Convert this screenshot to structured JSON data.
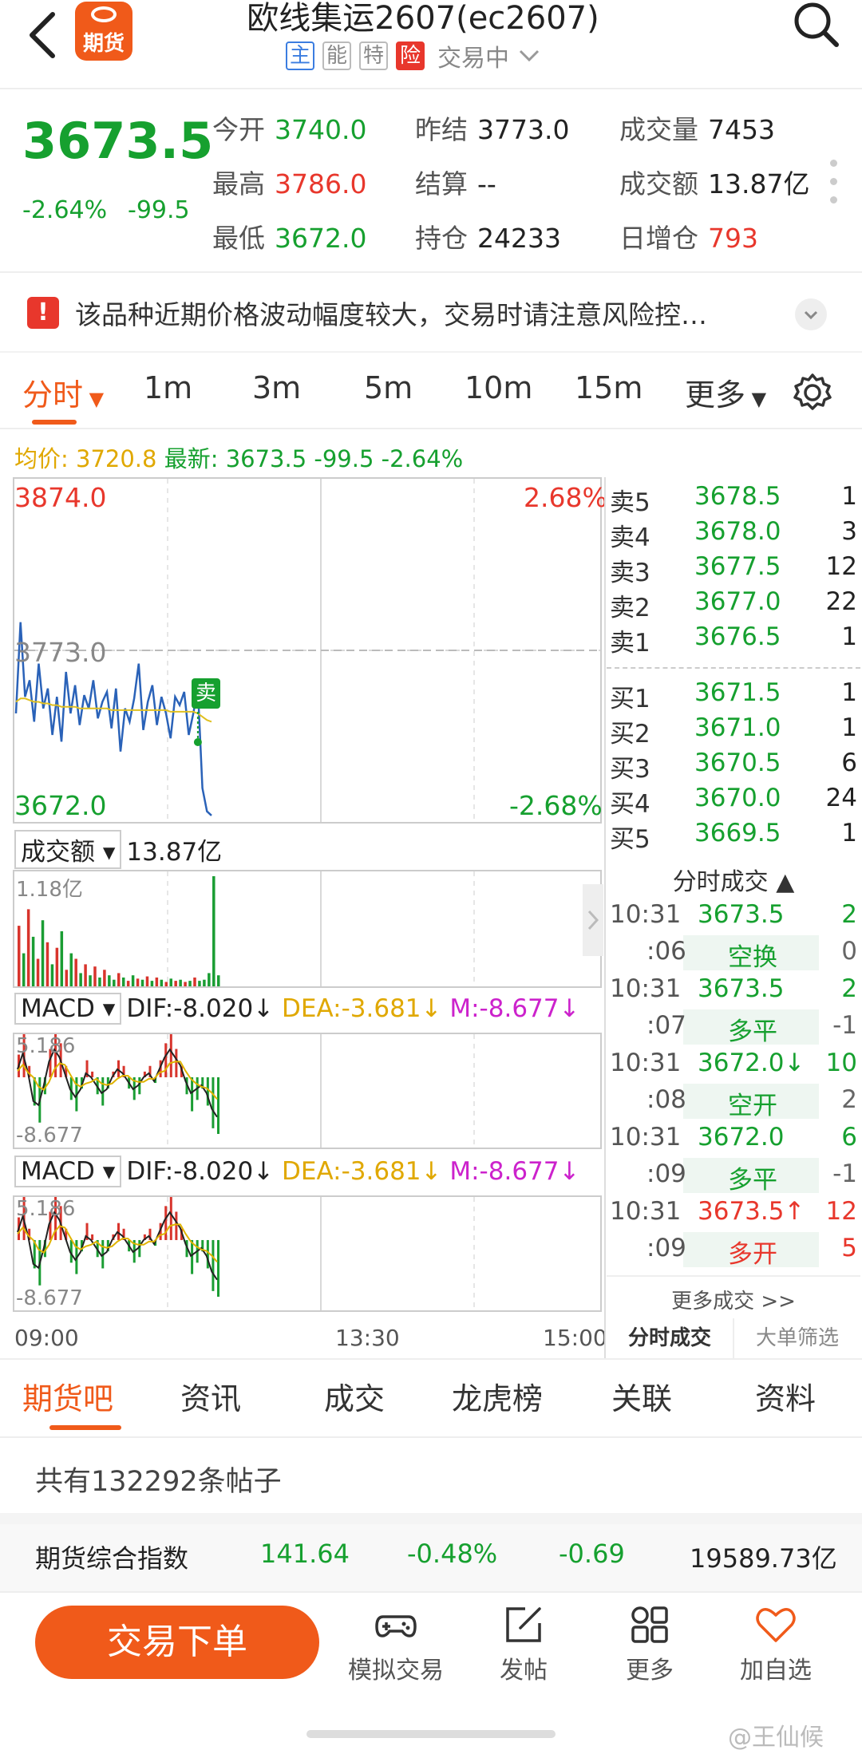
{
  "header": {
    "logo_text": "期货",
    "title": "欧线集运2607(ec2607)",
    "tags": [
      "主",
      "能",
      "特",
      "险"
    ],
    "status": "交易中"
  },
  "quote": {
    "last": "3673.5",
    "change_pct": "-2.64%",
    "change": "-99.5",
    "stats": {
      "open": {
        "label": "今开",
        "value": "3740.0"
      },
      "prev_settle": {
        "label": "昨结",
        "value": "3773.0"
      },
      "volume": {
        "label": "成交量",
        "value": "7453"
      },
      "high": {
        "label": "最高",
        "value": "3786.0"
      },
      "settle": {
        "label": "结算",
        "value": "--"
      },
      "turnover": {
        "label": "成交额",
        "value": "13.87亿"
      },
      "low": {
        "label": "最低",
        "value": "3672.0"
      },
      "open_interest": {
        "label": "持仓",
        "value": "24233"
      },
      "oi_change": {
        "label": "日增仓",
        "value": "793"
      }
    }
  },
  "warning": {
    "text": "该品种近期价格波动幅度较大，交易时请注意风险控…"
  },
  "period_tabs": [
    "分时",
    "1m",
    "3m",
    "5m",
    "10m",
    "15m",
    "更多"
  ],
  "avg_line": {
    "avg_label": "均价:",
    "avg_value": "3720.8",
    "latest_label": "最新:",
    "latest_value": "3673.5 -99.5 -2.64%"
  },
  "chart": {
    "top_price": "3874.0",
    "top_pct": "2.68%",
    "ref_price": "3773.0",
    "bottom_price": "3672.0",
    "bottom_pct": "-2.68%",
    "sell_marker": "卖",
    "time_start": "09:00",
    "time_mid": "13:30",
    "time_end": "15:00"
  },
  "chart_data": {
    "type": "line",
    "title": "",
    "ylim": [
      3672.0,
      3874.0
    ],
    "reference": 3773.0,
    "series": [
      {
        "values": [
          3735,
          3790,
          3745,
          3755,
          3730,
          3765,
          3738,
          3750,
          3722,
          3745,
          3718,
          3760,
          3735,
          3752,
          3728,
          3746,
          3738,
          3755,
          3732,
          3742,
          3748,
          3726,
          3750,
          3712,
          3738,
          3730,
          3744,
          3765,
          3725,
          3742,
          3752,
          3728,
          3745,
          3735,
          3720,
          3745,
          3740,
          3748,
          3722,
          3735,
          3750,
          3690,
          3676,
          3673.5
        ]
      },
      {
        "values": [
          3742,
          3744,
          3744,
          3743,
          3742,
          3742,
          3741,
          3741,
          3740,
          3740,
          3739,
          3739,
          3739,
          3739,
          3738,
          3738,
          3738,
          3738,
          3738,
          3738,
          3738,
          3737,
          3737,
          3737,
          3737,
          3737,
          3737,
          3737,
          3737,
          3737,
          3737,
          3737,
          3737,
          3737,
          3736,
          3736,
          3736,
          3736,
          3736,
          3736,
          3735,
          3733,
          3731,
          3730
        ]
      }
    ]
  },
  "volume_panel": {
    "label": "成交额",
    "value": "13.87亿",
    "max": "1.18亿",
    "bars": [
      0.55,
      0.3,
      0.7,
      0.45,
      0.25,
      0.6,
      0.4,
      0.2,
      0.35,
      0.5,
      0.15,
      0.3,
      0.25,
      0.12,
      0.2,
      0.1,
      0.18,
      0.08,
      0.15,
      0.1,
      0.06,
      0.12,
      0.08,
      0.05,
      0.1,
      0.07,
      0.06,
      0.09,
      0.05,
      0.08,
      0.06,
      0.04,
      0.07,
      0.05,
      0.06,
      0.04,
      0.05,
      0.08,
      0.05,
      0.06,
      0.12,
      1.0,
      0.1
    ],
    "bar_colors": [
      "red",
      "green",
      "red",
      "green",
      "red",
      "green",
      "red",
      "green",
      "red",
      "green",
      "red",
      "green",
      "red",
      "green",
      "red",
      "green",
      "red",
      "green",
      "red",
      "green",
      "green",
      "red",
      "green",
      "red",
      "green",
      "red",
      "green",
      "red",
      "green",
      "red",
      "green",
      "red",
      "green",
      "red",
      "green",
      "red",
      "green",
      "red",
      "green",
      "green",
      "green",
      "green",
      "green"
    ]
  },
  "macd1": {
    "name": "MACD",
    "dif": "DIF:-8.020↓",
    "dea": "DEA:-3.681↓",
    "m": "M:-8.677↓",
    "top": "5.186",
    "bottom": "-8.677"
  },
  "macd2": {
    "name": "MACD",
    "dif": "DIF:-8.020↓",
    "dea": "DEA:-3.681↓",
    "m": "M:-8.677↓",
    "top": "5.186",
    "bottom": "-8.677"
  },
  "macd_bars": [
    0.4,
    0.9,
    0.2,
    -0.5,
    -0.8,
    -0.3,
    0.5,
    0.9,
    0.6,
    0.2,
    -0.4,
    -0.6,
    -0.2,
    0.3,
    0.1,
    -0.3,
    -0.5,
    -0.2,
    0.1,
    0.3,
    0.2,
    -0.2,
    -0.4,
    -0.3,
    0.1,
    0.2,
    -0.1,
    0.3,
    0.6,
    0.8,
    0.5,
    0.2,
    -0.3,
    -0.6,
    -0.4,
    -0.2,
    -0.5,
    -0.9,
    -1.0
  ],
  "macd_line": [
    0.2,
    0.6,
    0.1,
    -0.6,
    -0.7,
    -0.2,
    0.4,
    0.7,
    0.5,
    0.1,
    -0.3,
    -0.5,
    -0.3,
    0.1,
    0.0,
    -0.2,
    -0.4,
    -0.3,
    0.0,
    0.2,
    0.1,
    -0.1,
    -0.3,
    -0.2,
    0.0,
    0.1,
    -0.1,
    0.2,
    0.5,
    0.7,
    0.5,
    0.3,
    -0.1,
    -0.4,
    -0.3,
    -0.2,
    -0.4,
    -0.8,
    -1.0
  ],
  "order_book": {
    "asks": [
      {
        "label": "卖5",
        "price": "3678.5",
        "qty": "1"
      },
      {
        "label": "卖4",
        "price": "3678.0",
        "qty": "3"
      },
      {
        "label": "卖3",
        "price": "3677.5",
        "qty": "12"
      },
      {
        "label": "卖2",
        "price": "3677.0",
        "qty": "22"
      },
      {
        "label": "卖1",
        "price": "3676.5",
        "qty": "1"
      }
    ],
    "bids": [
      {
        "label": "买1",
        "price": "3671.5",
        "qty": "1"
      },
      {
        "label": "买2",
        "price": "3671.0",
        "qty": "1"
      },
      {
        "label": "买3",
        "price": "3670.5",
        "qty": "6"
      },
      {
        "label": "买4",
        "price": "3670.0",
        "qty": "24"
      },
      {
        "label": "买5",
        "price": "3669.5",
        "qty": "1"
      }
    ]
  },
  "trades": {
    "title": "分时成交 ▲",
    "rows": [
      {
        "time": "10:31",
        "price": "3673.5",
        "qty": "2",
        "sec": ":06",
        "type": "空换",
        "oi": "0",
        "type_color": "green",
        "qty_color": "green",
        "oi_color": "gray"
      },
      {
        "time": "10:31",
        "price": "3673.5",
        "qty": "2",
        "sec": ":07",
        "type": "多平",
        "oi": "-1",
        "type_color": "green",
        "qty_color": "green",
        "oi_color": "gray"
      },
      {
        "time": "10:31",
        "price": "3672.0↓",
        "qty": "10",
        "sec": ":08",
        "type": "空开",
        "oi": "2",
        "type_color": "green",
        "qty_color": "green",
        "oi_color": "gray"
      },
      {
        "time": "10:31",
        "price": "3672.0",
        "qty": "6",
        "sec": ":09",
        "type": "多平",
        "oi": "-1",
        "type_color": "green",
        "qty_color": "green",
        "oi_color": "gray"
      },
      {
        "time": "10:31",
        "price": "3673.5↑",
        "qty": "12",
        "sec": ":09",
        "type": "多开",
        "oi": "5",
        "type_color": "red",
        "qty_color": "red",
        "oi_color": "gray"
      }
    ],
    "more": "更多成交 >>",
    "tab1": "分时成交",
    "tab2": "大单筛选"
  },
  "content_tabs": [
    "期货吧",
    "资讯",
    "成交",
    "龙虎榜",
    "关联",
    "资料"
  ],
  "posts_count": "共有132292条帖子",
  "index_strip": {
    "name": "期货综合指数",
    "value": "141.64",
    "pct": "-0.48%",
    "change": "-0.69",
    "turnover": "19589.73亿"
  },
  "bottom_bar": {
    "trade_button": "交易下单",
    "items": [
      "模拟交易",
      "发帖",
      "更多",
      "加自选"
    ]
  },
  "watermark": "@王仙候"
}
